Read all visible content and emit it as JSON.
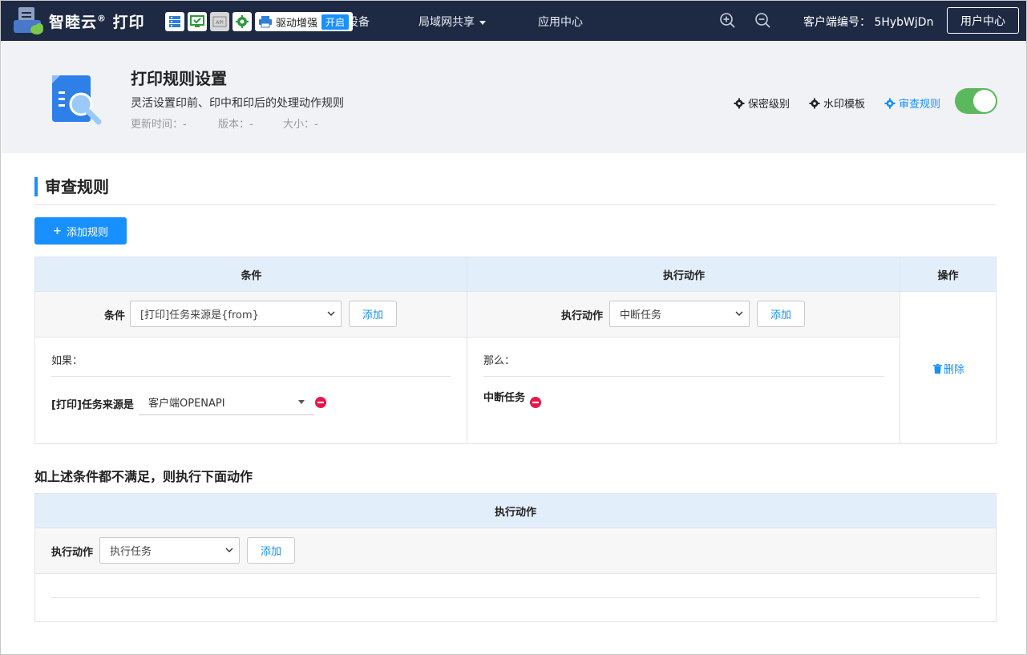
{
  "topbar": {
    "brand": "智睦云",
    "brand_reg": "®",
    "brand_suffix": " 打印",
    "tools": [
      "server-icon",
      "monitor-check-icon",
      "api-icon",
      "gear-icon"
    ],
    "tool_api_label": "API",
    "driver_label": "驱动增强",
    "driver_badge": "开启",
    "devices_partial": "设备",
    "nav": [
      {
        "label": "局域网共享",
        "has_caret": true
      },
      {
        "label": "应用中心",
        "has_caret": false
      }
    ],
    "client_label": "客户端编号：",
    "client_id": "5HybWjDn",
    "user_center": "用户中心"
  },
  "header": {
    "title": "打印规则设置",
    "description": "灵活设置印前、印中和印后的处理动作规则",
    "meta": {
      "update_time": "更新时间：-",
      "version": "版本：-",
      "size": "大小：-"
    },
    "links": {
      "confidential": "保密级别",
      "watermark": "水印模板",
      "audit_rules": "审查规则"
    },
    "toggle_on": true
  },
  "section": {
    "title": "审查规则",
    "add_rule": "添加规则"
  },
  "rule_table": {
    "col_condition": "条件",
    "col_action": "执行动作",
    "col_ops": "操作",
    "condition_label": "条件",
    "condition_select": "[打印]任务来源是{from}",
    "condition_add": "添加",
    "action_label": "执行动作",
    "action_select": "中断任务",
    "action_add": "添加",
    "if_label": "如果：",
    "then_label": "那么：",
    "cond_item_label": "[打印]任务来源是",
    "cond_item_value": "客户端OPENAPI",
    "action_item_label": "中断任务",
    "delete": "删除"
  },
  "else_section": {
    "title": "如上述条件都不满足，则执行下面动作",
    "col_action": "执行动作",
    "action_label": "执行动作",
    "action_select": "执行任务",
    "action_add": "添加"
  }
}
